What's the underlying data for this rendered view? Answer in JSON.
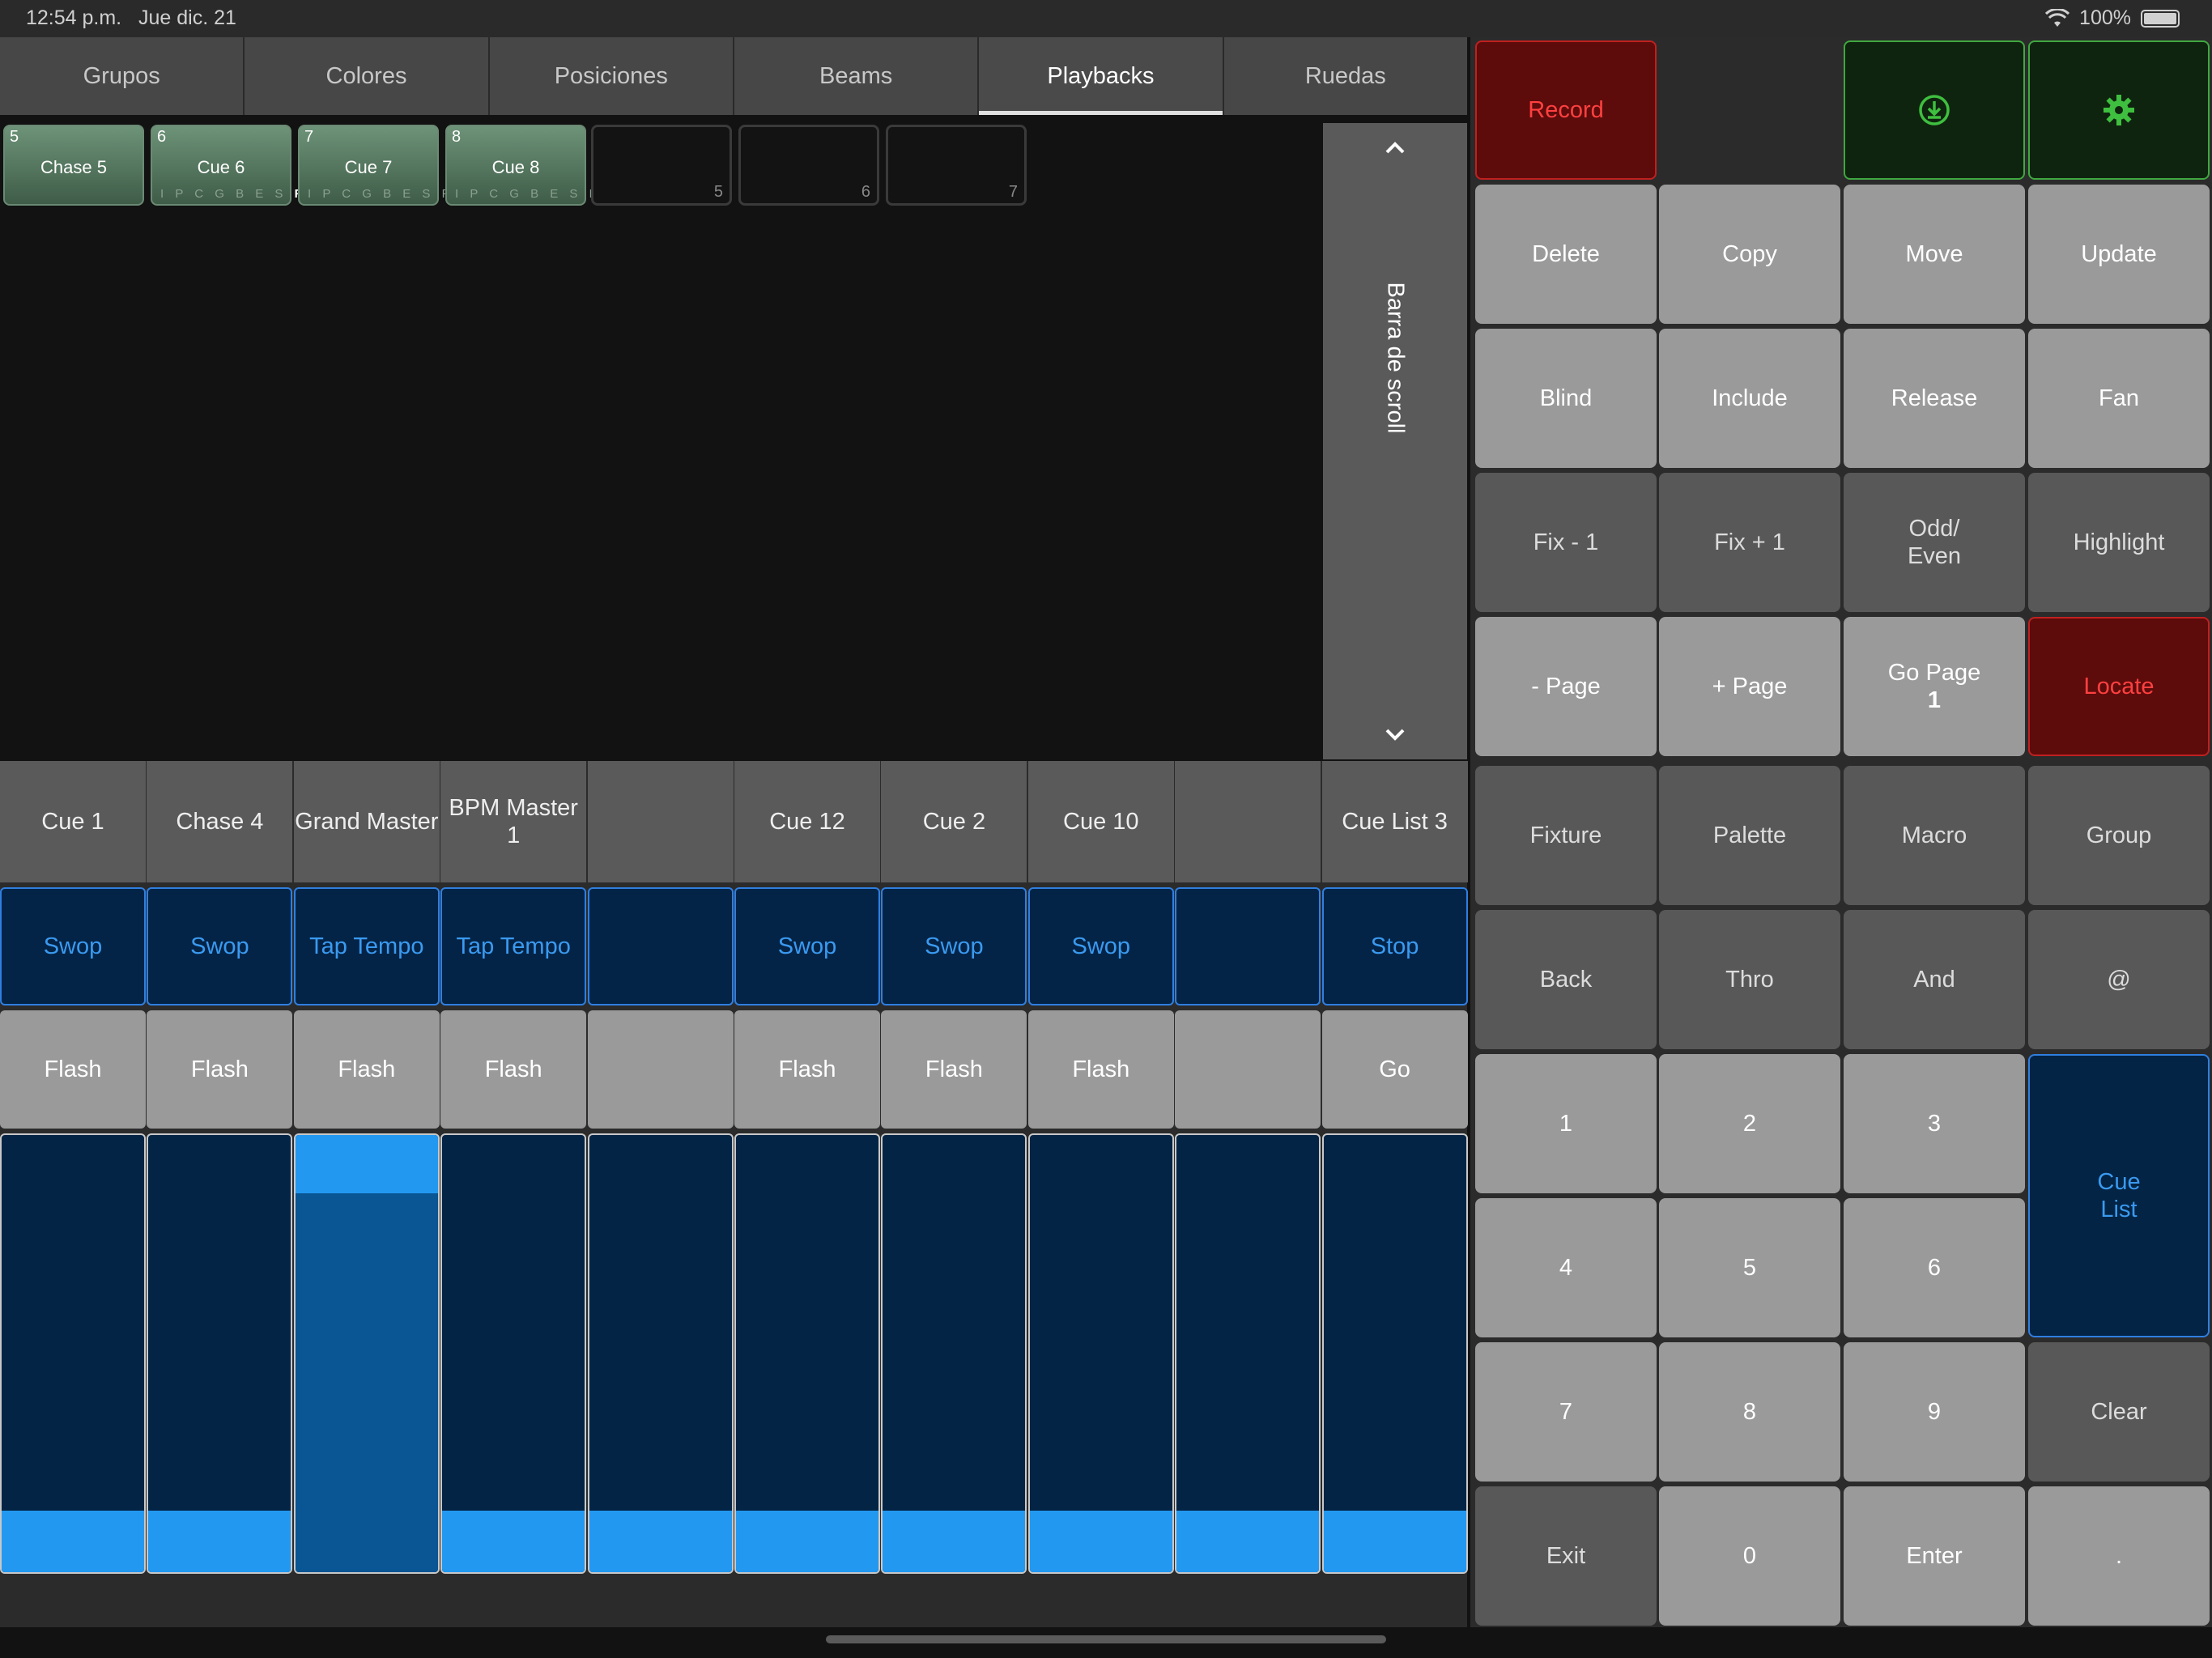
{
  "status": {
    "time": "12:54 p.m.",
    "date": "Jue dic. 21",
    "battery": "100%"
  },
  "tabs": [
    {
      "label": "Grupos"
    },
    {
      "label": "Colores"
    },
    {
      "label": "Posiciones"
    },
    {
      "label": "Beams"
    },
    {
      "label": "Playbacks",
      "active": true
    },
    {
      "label": "Ruedas"
    }
  ],
  "cues": [
    {
      "num": "5",
      "name": "Chase 5",
      "flags": "",
      "fx": ""
    },
    {
      "num": "6",
      "name": "Cue 6",
      "flags": "I P C G B E S",
      "fx": "FX"
    },
    {
      "num": "7",
      "name": "Cue 7",
      "flags": "I P C G B E S FX",
      "fx": ""
    },
    {
      "num": "8",
      "name": "Cue 8",
      "flags": "I P C G B E S FX",
      "fx": ""
    }
  ],
  "empty_cells": [
    "5",
    "6",
    "7"
  ],
  "scrollbar": {
    "label": "Barra de scroll"
  },
  "playbacks": [
    {
      "name": "Cue 1",
      "top": "Swop",
      "bottom": "Flash",
      "level": 0
    },
    {
      "name": "Chase 4",
      "top": "Swop",
      "bottom": "Flash",
      "level": 0
    },
    {
      "name": "Grand Master",
      "top": "Tap Tempo",
      "bottom": "Flash",
      "level": 1.0
    },
    {
      "name": "BPM Master 1",
      "top": "Tap Tempo",
      "bottom": "Flash",
      "level": 0
    },
    {
      "name": "",
      "top": "",
      "bottom": "",
      "level": 0
    },
    {
      "name": "Cue 12",
      "top": "Swop",
      "bottom": "Flash",
      "level": 0
    },
    {
      "name": "Cue 2",
      "top": "Swop",
      "bottom": "Flash",
      "level": 0
    },
    {
      "name": "Cue 10",
      "top": "Swop",
      "bottom": "Flash",
      "level": 0
    },
    {
      "name": "",
      "top": "",
      "bottom": "",
      "level": 0
    },
    {
      "name": "Cue List 3",
      "top": "Stop",
      "bottom": "Go",
      "level": 0
    }
  ],
  "keys": {
    "record": "Record",
    "delete": "Delete",
    "copy": "Copy",
    "move": "Move",
    "update": "Update",
    "blind": "Blind",
    "include": "Include",
    "release": "Release",
    "fan": "Fan",
    "fix_minus": "Fix - 1",
    "fix_plus": "Fix + 1",
    "odd_even": "Odd/\nEven",
    "highlight": "Highlight",
    "page_minus": "- Page",
    "page_plus": "+ Page",
    "go_page": "Go Page",
    "go_page_num": "1",
    "locate": "Locate",
    "fixture": "Fixture",
    "palette": "Palette",
    "macro": "Macro",
    "group": "Group",
    "back": "Back",
    "thro": "Thro",
    "and": "And",
    "at": "@",
    "n1": "1",
    "n2": "2",
    "n3": "3",
    "cue_list": "Cue\nList",
    "n4": "4",
    "n5": "5",
    "n6": "6",
    "n7": "7",
    "n8": "8",
    "n9": "9",
    "clear": "Clear",
    "exit": "Exit",
    "n0": "0",
    "enter": "Enter",
    "dot": "."
  },
  "colors": {
    "accent_blue": "#2398f0",
    "record_red": "#5e0b0b",
    "cue_green": "#5a7d64"
  }
}
